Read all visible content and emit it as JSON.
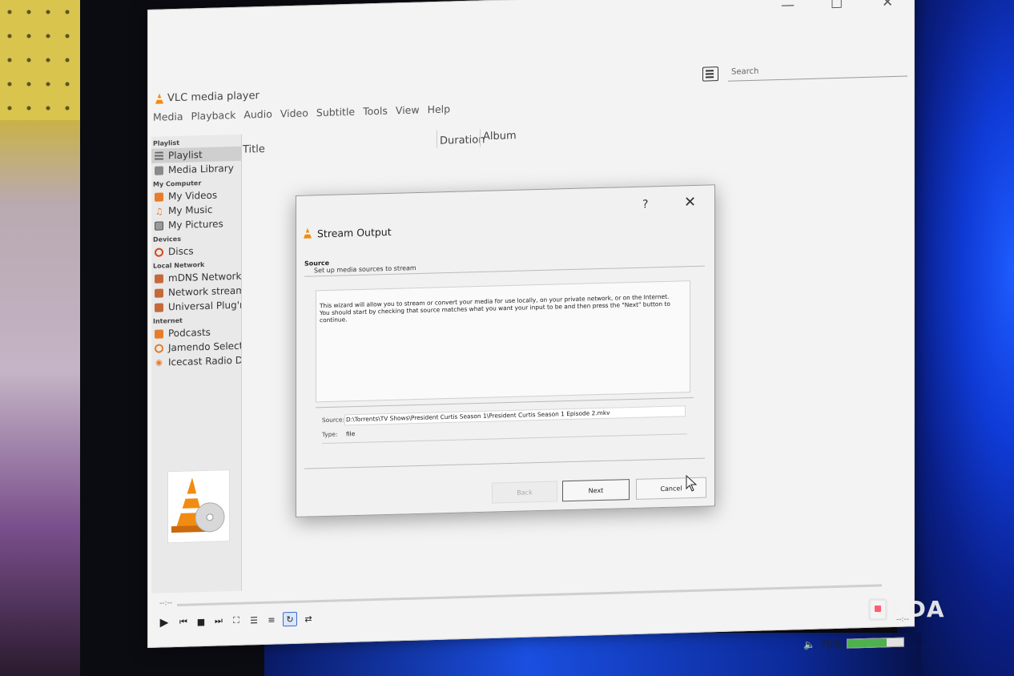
{
  "window": {
    "title": "VLC media player",
    "menu": [
      "Media",
      "Playback",
      "Audio",
      "Video",
      "Subtitle",
      "Tools",
      "View",
      "Help"
    ],
    "search_placeholder": "Search"
  },
  "sidebar": {
    "sections": [
      {
        "heading": "Playlist",
        "items": [
          {
            "label": "Playlist",
            "icon": "playlist-icon",
            "selected": true
          },
          {
            "label": "Media Library",
            "icon": "media-library-icon"
          }
        ]
      },
      {
        "heading": "My Computer",
        "items": [
          {
            "label": "My Videos",
            "icon": "videos-icon"
          },
          {
            "label": "My Music",
            "icon": "music-icon"
          },
          {
            "label": "My Pictures",
            "icon": "pictures-icon"
          }
        ]
      },
      {
        "heading": "Devices",
        "items": [
          {
            "label": "Discs",
            "icon": "disc-icon"
          }
        ]
      },
      {
        "heading": "Local Network",
        "items": [
          {
            "label": "mDNS Network...",
            "icon": "network-icon"
          },
          {
            "label": "Network stream...",
            "icon": "network-icon"
          },
          {
            "label": "Universal Plug'n...",
            "icon": "network-icon"
          }
        ]
      },
      {
        "heading": "Internet",
        "items": [
          {
            "label": "Podcasts",
            "icon": "podcast-icon"
          },
          {
            "label": "Jamendo Selecti...",
            "icon": "jamendo-icon"
          },
          {
            "label": "Icecast Radio Di...",
            "icon": "radio-icon"
          }
        ]
      }
    ]
  },
  "playlist_columns": [
    "Title",
    "Duration",
    "Album"
  ],
  "player": {
    "time_elapsed": "--:--",
    "time_total": "--:--",
    "volume_label": "70%",
    "volume_fraction": 0.7
  },
  "dialog": {
    "title": "Stream Output",
    "help": "?",
    "section": "Source",
    "subtitle": "Set up media sources to stream",
    "info_line1": "This wizard will allow you to stream or convert your media for use locally, on your private network, or on the Internet.",
    "info_line2": "You should start by checking that source matches what you want your input to be and then press the \"Next\" button to continue.",
    "source_label": "Source:",
    "source_value": "D:\\Torrents\\TV Shows\\President Curtis Season 1\\President Curtis Season 1 Episode 2.mkv",
    "type_label": "Type:",
    "type_value": "file",
    "buttons": {
      "back": "Back",
      "next": "Next",
      "cancel": "Cancel"
    }
  },
  "watermark": {
    "text": "XDA"
  },
  "colors": {
    "vlc_orange": "#f28b12",
    "accent_blue": "#1e5cff",
    "watermark_red": "#ff4f6a"
  }
}
